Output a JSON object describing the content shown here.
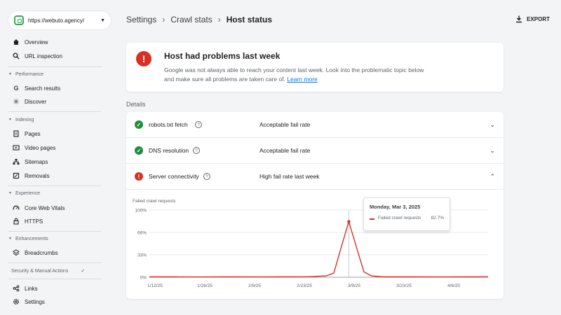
{
  "sidebar": {
    "property_url": "https://webuto.agency/",
    "items_top": [
      {
        "label": "Overview",
        "icon": "home-icon"
      },
      {
        "label": "URL inspection",
        "icon": "search-icon"
      }
    ],
    "sections": [
      {
        "title": "Performance",
        "items": [
          {
            "label": "Search results",
            "icon": "google-g-icon"
          },
          {
            "label": "Discover",
            "icon": "asterisk-icon"
          }
        ]
      },
      {
        "title": "Indexing",
        "items": [
          {
            "label": "Pages",
            "icon": "pages-icon"
          },
          {
            "label": "Video pages",
            "icon": "video-pages-icon"
          },
          {
            "label": "Sitemaps",
            "icon": "sitemaps-icon"
          },
          {
            "label": "Removals",
            "icon": "removals-icon"
          }
        ]
      },
      {
        "title": "Experience",
        "items": [
          {
            "label": "Core Web Vitals",
            "icon": "gauge-icon"
          },
          {
            "label": "HTTPS",
            "icon": "lock-icon"
          }
        ]
      },
      {
        "title": "Enhancements",
        "items": [
          {
            "label": "Breadcrumbs",
            "icon": "layers-icon"
          }
        ]
      }
    ],
    "security_label": "Security & Manual Actions",
    "items_bottom": [
      {
        "label": "Links",
        "icon": "link-icon"
      },
      {
        "label": "Settings",
        "icon": "gear-icon"
      }
    ]
  },
  "header": {
    "crumbs": [
      "Settings",
      "Crawl stats",
      "Host status"
    ],
    "export_label": "EXPORT"
  },
  "alert": {
    "title": "Host had problems last week",
    "text": "Google was not always able to reach your content last week. Look into the problematic topic below and make sure all problems are taken care of.",
    "link": "Learn more"
  },
  "details": {
    "label": "Details",
    "rows": [
      {
        "name": "robots.txt fetch",
        "rate": "Acceptable fail rate",
        "status": "ok"
      },
      {
        "name": "DNS resolution",
        "rate": "Acceptable fail rate",
        "status": "ok"
      },
      {
        "name": "Server connectivity",
        "rate": "High fail rate last week",
        "status": "error"
      }
    ]
  },
  "colors": {
    "ok": "#1e8e3e",
    "error": "#d93025",
    "line": "#d93025",
    "link": "#1a73e8"
  },
  "chart_data": {
    "type": "line",
    "title": "Failed crawl requests",
    "ylim": [
      0,
      100
    ],
    "y_ticks": [
      "0%",
      "33%",
      "66%",
      "100%"
    ],
    "x_tick_labels": [
      "1/12/25",
      "1/26/25",
      "2/9/25",
      "2/23/25",
      "3/9/25",
      "3/23/25",
      "4/6/25"
    ],
    "x_start": "2025-01-09",
    "x_end": "2025-04-09",
    "series": [
      {
        "name": "Failed crawl requests",
        "x": [
          "2025-01-09",
          "2025-01-16",
          "2025-01-23",
          "2025-01-30",
          "2025-02-06",
          "2025-02-13",
          "2025-02-20",
          "2025-02-25",
          "2025-02-27",
          "2025-03-01",
          "2025-03-03",
          "2025-03-05",
          "2025-03-07",
          "2025-03-09",
          "2025-03-12",
          "2025-03-19",
          "2025-03-26",
          "2025-04-02",
          "2025-04-09"
        ],
        "values": [
          0.5,
          0.5,
          0.3,
          0.5,
          0.4,
          0.5,
          0.6,
          2,
          6,
          45,
          82.7,
          45,
          8,
          2,
          0.5,
          0.5,
          0.4,
          0.5,
          0.5
        ]
      }
    ],
    "tooltip": {
      "date": "Monday, Mar 3, 2025",
      "series": "Failed crawl requests",
      "value": "82.7%",
      "x": "2025-03-03"
    },
    "grid": true
  }
}
